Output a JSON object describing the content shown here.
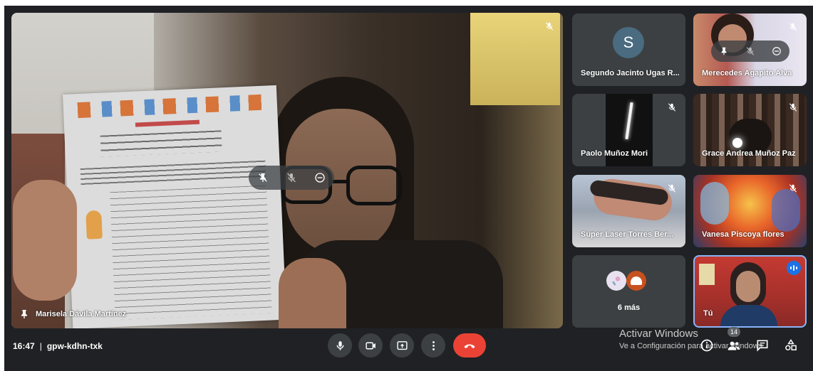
{
  "meeting": {
    "time": "16:47",
    "separator": "|",
    "code": "gpw-kdhn-txk"
  },
  "main": {
    "presenter_name": "Marisela Dávila Martínez"
  },
  "hover_menu_icons": [
    "pin-icon",
    "mic-off-icon",
    "remove-icon"
  ],
  "participants": [
    {
      "name": "Segundo Jacinto Ugas R...",
      "avatar_letter": "S",
      "muted": true
    },
    {
      "name": "Merecedes Agapito Alva",
      "muted": true
    },
    {
      "name": "Paolo Muñoz Mori",
      "muted": true
    },
    {
      "name": "Grace Andrea Muñoz Paz",
      "muted": true
    },
    {
      "name": "Super Laser Torres Ber...",
      "muted": true
    },
    {
      "name": "Vanesa Piscoya flores",
      "muted": true
    },
    {
      "name": "6 más"
    },
    {
      "name": "Tú",
      "speaking": true
    }
  ],
  "people_count": "14",
  "activation": {
    "title": "Activar Windows",
    "subtitle": "Ve a Configuración para activar Windows."
  },
  "colors": {
    "background": "#202124",
    "tile_gray": "#3c4043",
    "end_call": "#ea4335",
    "avatar": "#4a6b80",
    "speaking_border": "#8ab4f8",
    "speaking_badge": "#1a73e8"
  }
}
